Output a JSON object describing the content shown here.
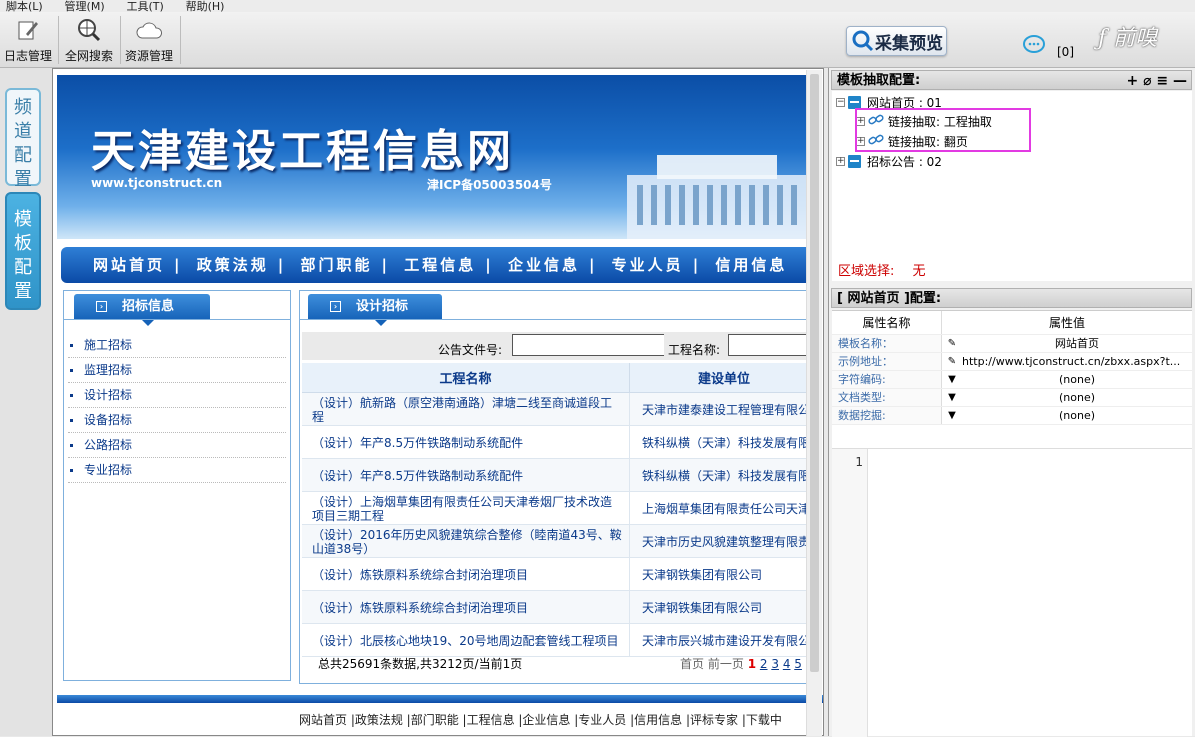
{
  "menubar": [
    "脚本(L)",
    "管理(M)",
    "工具(T)",
    "帮助(H)"
  ],
  "toolbar": {
    "log_label": "日志管理",
    "search_label": "全网搜索",
    "resource_label": "资源管理",
    "preview_label": "采集预览",
    "message_count": "[0]",
    "logo_text": "ƒ 前嗅"
  },
  "sidetabs": {
    "channel": "频道配置",
    "template": "模板配置"
  },
  "site": {
    "title": "天津建设工程信息网",
    "url": "www.tjconstruct.cn",
    "icp": "津ICP备05003504号",
    "nav": [
      "网站首页",
      "政策法规",
      "部门职能",
      "工程信息",
      "企业信息",
      "专业人员",
      "信用信息"
    ],
    "left_tab": "招标信息",
    "left_items": [
      "施工招标",
      "监理招标",
      "设计招标",
      "设备招标",
      "公路招标",
      "专业招标"
    ],
    "right_tab": "设计招标",
    "search_label_1": "公告文件号:",
    "search_label_2": "工程名称:",
    "col_name": "工程名称",
    "col_unit": "建设单位",
    "rows": [
      {
        "name": "（设计）航新路（原空港南通路）津塘二线至商诚道段工程",
        "unit": "天津市建泰建设工程管理有限公司"
      },
      {
        "name": "（设计）年产8.5万件铁路制动系统配件",
        "unit": "铁科纵横（天津）科技发展有限公司"
      },
      {
        "name": "（设计）年产8.5万件铁路制动系统配件",
        "unit": "铁科纵横（天津）科技发展有限公司"
      },
      {
        "name": "（设计）上海烟草集团有限责任公司天津卷烟厂技术改造项目三期工程",
        "unit": "上海烟草集团有限责任公司天津卷烟厂"
      },
      {
        "name": "（设计）2016年历史风貌建筑综合整修（睦南道43号、鞍山道38号）",
        "unit": "天津市历史风貌建筑整理有限责任公司"
      },
      {
        "name": "（设计）炼铁原料系统综合封闭治理项目",
        "unit": "天津钢铁集团有限公司"
      },
      {
        "name": "（设计）炼铁原料系统综合封闭治理项目",
        "unit": "天津钢铁集团有限公司"
      },
      {
        "name": "（设计）北辰核心地块19、20号地周边配套管线工程项目",
        "unit": "天津市辰兴城市建设开发有限公司"
      }
    ],
    "summary": "总共25691条数据,共3212页/当前1页",
    "pager": {
      "first": "首页",
      "prev": "前一页",
      "current": "1",
      "pages": [
        "2",
        "3",
        "4",
        "5"
      ]
    },
    "footer": "网站首页 |政策法规 |部门职能 |工程信息 |企业信息 |专业人员 |信用信息 |评标专家 |下载中"
  },
  "right": {
    "tree_title": "模板抽取配置:",
    "tree_tools": "+ ⌀ ≡ —",
    "tree": [
      {
        "label": "网站首页 : 01"
      },
      {
        "label": "链接抽取: 工程抽取"
      },
      {
        "label": "链接抽取: 翻页"
      },
      {
        "label": "招标公告 : 02"
      }
    ],
    "region_label": "区域选择:",
    "region_value": "无",
    "config_title": "[ 网站首页 ]配置:",
    "prop_header_name": "属性名称",
    "prop_header_value": "属性值",
    "props": [
      {
        "name": "模板名称：",
        "value": "网站首页"
      },
      {
        "name": "示例地址：",
        "value": "http://www.tjconstruct.cn/zbxx.aspx?t..."
      },
      {
        "name": "字符编码:",
        "value": "(none)"
      },
      {
        "name": "文档类型:",
        "value": "(none)"
      },
      {
        "name": "数据挖掘:",
        "value": "(none)"
      }
    ],
    "line_number": "1"
  },
  "colors": {
    "accent_blue": "#1562b8",
    "highlight_magenta": "#e23ae2",
    "region_red": "#cc0000"
  }
}
